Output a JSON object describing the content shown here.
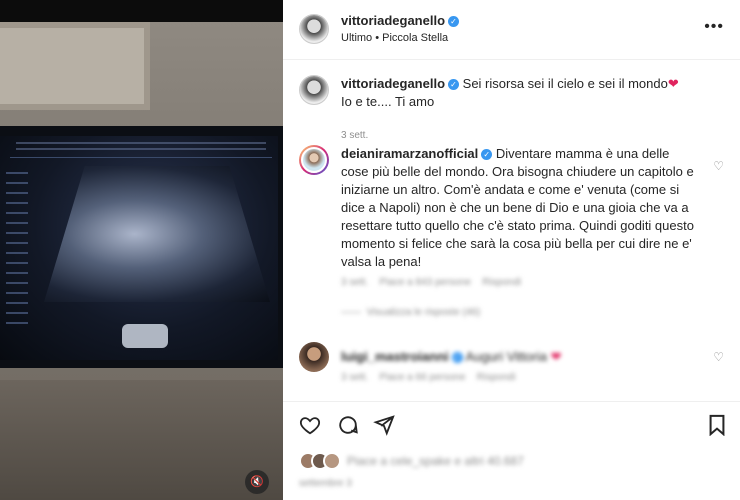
{
  "post": {
    "username": "vittoriadeganello",
    "location": "Ultimo • Piccola Stella",
    "more_label": "•••",
    "mute_label": "🔇"
  },
  "caption": {
    "username": "vittoriadeganello",
    "text_line1": "Sei risorsa sei il cielo e sei il mondo",
    "heart": "❤",
    "text_line2": "Io e te.... Ti amo",
    "time": "3 sett."
  },
  "comments": [
    {
      "username": "deianiramarzanofficial",
      "text": "Diventare mamma è una delle cose più belle del mondo. Ora bisogna chiudere un capitolo e iniziarne un altro. Com'è andata e come e' venuta (come si dice a Napoli) non è che un bene di Dio e una gioia che va a resettare tutto quello che c'è stato prima. Quindi goditi questo momento si felice che sarà la cosa più bella per cui dire ne e' valsa la pena!",
      "meta_time": "3 sett.",
      "meta_likes": "Piace a 843 persone",
      "meta_reply": "Rispondi",
      "view_replies": "Visualizza le risposte (46)",
      "heart": "♡"
    },
    {
      "username": "luigi_mastroianni",
      "text": "Auguri Vittoria",
      "heart_red": "❤",
      "meta_time": "3 sett.",
      "meta_likes": "Piace a 66 persone",
      "meta_reply": "Rispondi",
      "heart": "♡"
    }
  ],
  "actions": {
    "like_icon": "heart-outline",
    "comment_icon": "comment-outline",
    "share_icon": "paper-plane",
    "save_icon": "bookmark"
  },
  "likes_text": "Piace a cele_spake e altri 40.687",
  "post_date": "settembre 3"
}
